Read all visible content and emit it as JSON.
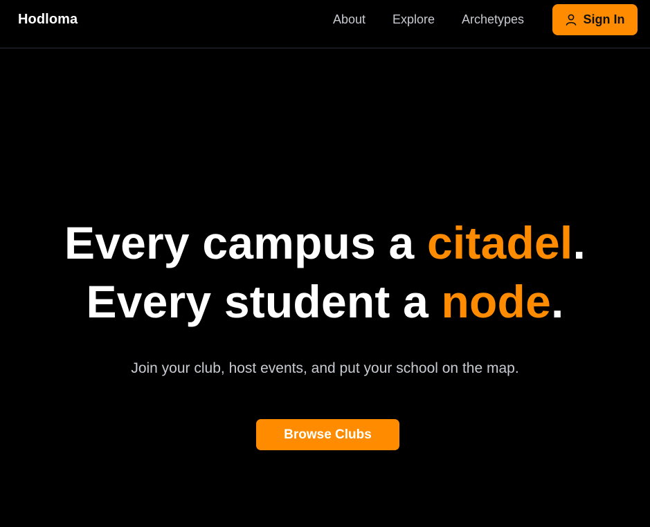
{
  "header": {
    "logo": "Hodloma",
    "nav": {
      "about": "About",
      "explore": "Explore",
      "archetypes": "Archetypes"
    },
    "signin": {
      "label": "Sign In",
      "icon": "user-icon"
    }
  },
  "hero": {
    "line1": {
      "prefix": "Every campus a ",
      "highlight": "citadel",
      "suffix": "."
    },
    "line2": {
      "prefix": "Every student a ",
      "highlight": "node",
      "suffix": "."
    },
    "subtitle": "Join your club, host events, and put your school on the map.",
    "cta_label": "Browse Clubs"
  },
  "colors": {
    "background": "#000000",
    "accent": "#ff8c00",
    "text": "#ffffff",
    "muted_text": "#c9cbd2",
    "divider": "#2b2f3a"
  }
}
